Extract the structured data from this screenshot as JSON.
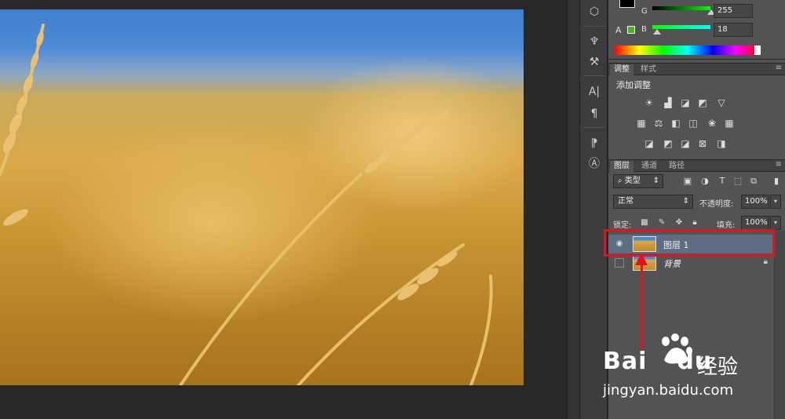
{
  "color_panel": {
    "g_label": "G",
    "g_value": "255",
    "b_label": "B",
    "b_value": "18",
    "warn_label": "A",
    "foreground_color": "#000000",
    "gamut_color": "#4caf2a"
  },
  "adjustments_panel": {
    "tabs": [
      "调整",
      "样式"
    ],
    "title": "添加调整"
  },
  "layers_panel": {
    "tabs": [
      "图层",
      "通道",
      "路径"
    ],
    "kind_filter": "类型",
    "blend_mode": "正常",
    "opacity_label": "不透明度:",
    "opacity_value": "100%",
    "lock_label": "锁定:",
    "fill_label": "填充:",
    "fill_value": "100%",
    "layers": [
      {
        "name": "图层 1",
        "visible": true,
        "selected": true
      },
      {
        "name": "背景",
        "visible": false,
        "selected": false,
        "locked": true
      }
    ]
  },
  "annotation": {
    "highlight_color": "#e0141e"
  },
  "watermark": {
    "brand": "Bai",
    "brand2": "du",
    "cn": "经验",
    "url": "jingyan.baidu.com"
  }
}
